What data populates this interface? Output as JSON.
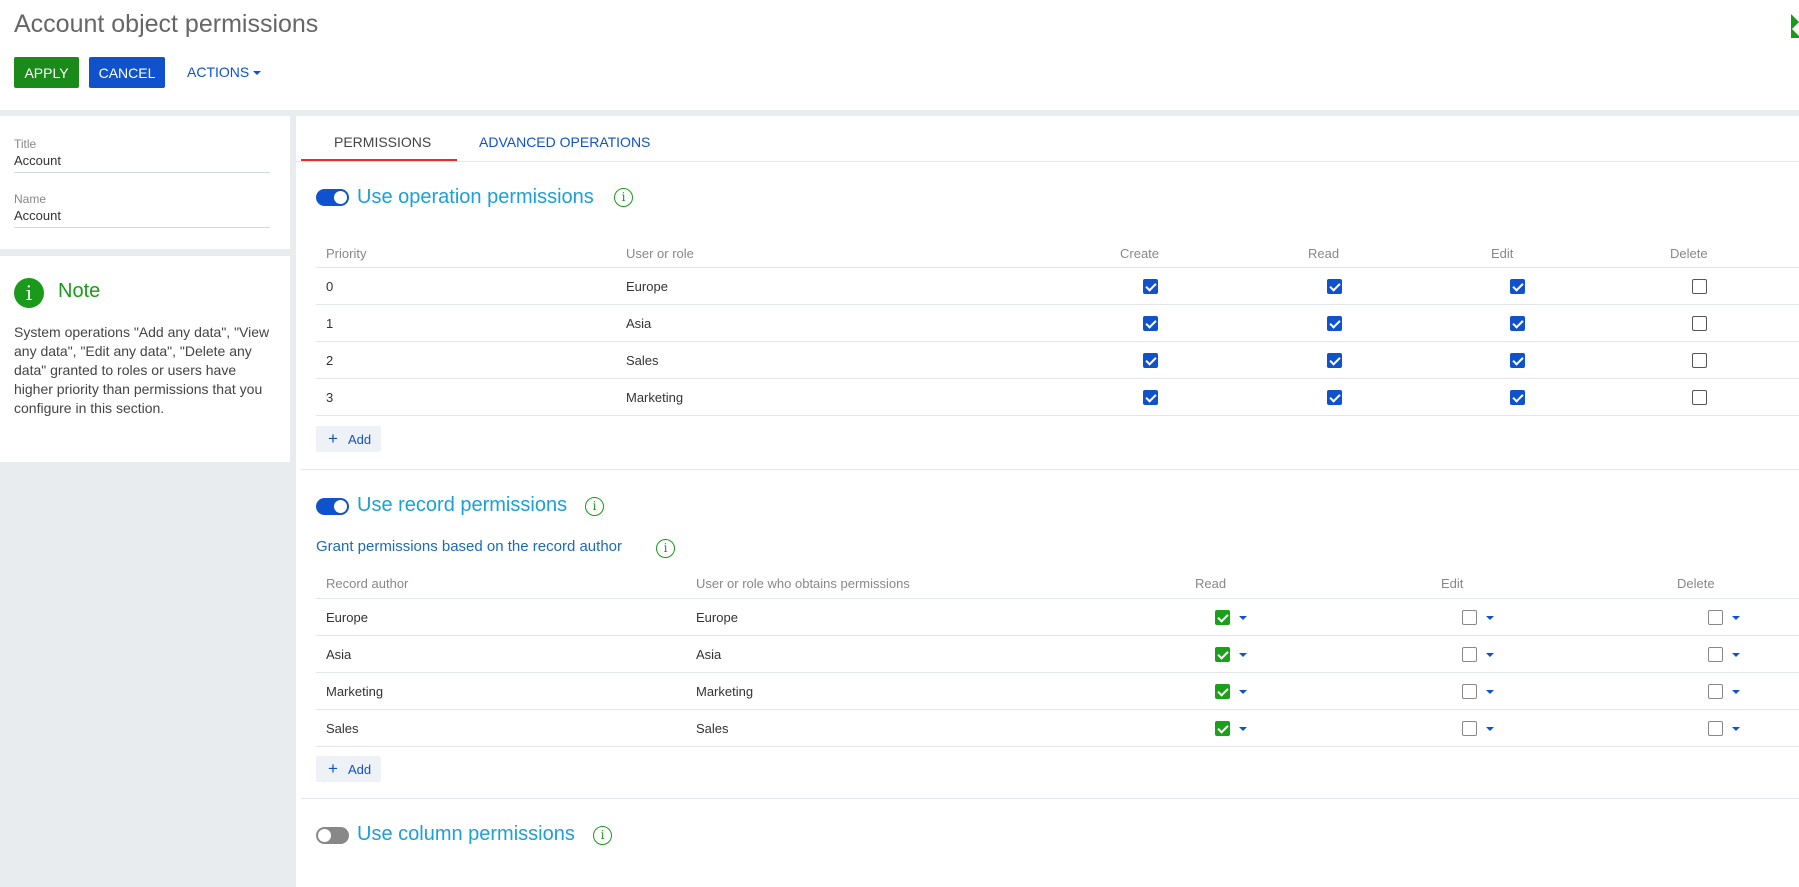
{
  "header": {
    "title": "Account object permissions",
    "apply_label": "APPLY",
    "cancel_label": "CANCEL",
    "actions_label": "ACTIONS"
  },
  "fields": {
    "title_label": "Title",
    "title_value": "Account",
    "name_label": "Name",
    "name_value": "Account"
  },
  "note": {
    "icon_glyph": "i",
    "title": "Note",
    "text": "System operations \"Add any data\", \"View any data\", \"Edit any data\", \"Delete any data\" granted to roles or users have higher priority than permissions that you configure in this section."
  },
  "tabs": {
    "permissions": "PERMISSIONS",
    "advanced": "ADVANCED OPERATIONS"
  },
  "operation": {
    "title": "Use operation permissions",
    "enabled": true,
    "columns": [
      "Priority",
      "User or role",
      "Create",
      "Read",
      "Edit",
      "Delete"
    ],
    "rows": [
      {
        "priority": "0",
        "role": "Europe",
        "create": true,
        "read": true,
        "edit": true,
        "delete": false
      },
      {
        "priority": "1",
        "role": "Asia",
        "create": true,
        "read": true,
        "edit": true,
        "delete": false
      },
      {
        "priority": "2",
        "role": "Sales",
        "create": true,
        "read": true,
        "edit": true,
        "delete": false
      },
      {
        "priority": "3",
        "role": "Marketing",
        "create": true,
        "read": true,
        "edit": true,
        "delete": false
      }
    ],
    "add_label": "Add"
  },
  "record": {
    "title": "Use record permissions",
    "enabled": true,
    "subtitle": "Grant permissions based on the record author",
    "columns": [
      "Record author",
      "User or role who obtains permissions",
      "Read",
      "Edit",
      "Delete"
    ],
    "rows": [
      {
        "author": "Europe",
        "grantee": "Europe",
        "read": true,
        "edit": false,
        "delete": false
      },
      {
        "author": "Asia",
        "grantee": "Asia",
        "read": true,
        "edit": false,
        "delete": false
      },
      {
        "author": "Marketing",
        "grantee": "Marketing",
        "read": true,
        "edit": false,
        "delete": false
      },
      {
        "author": "Sales",
        "grantee": "Sales",
        "read": true,
        "edit": false,
        "delete": false
      }
    ],
    "add_label": "Add"
  },
  "column": {
    "title": "Use column permissions",
    "enabled": false
  },
  "colors": {
    "accent_blue": "#0f52cc",
    "apply_green": "#1a8a1a",
    "section_title": "#1ba0d8",
    "tab_underline": "#e52d2d",
    "check_green": "#1aa01a"
  }
}
